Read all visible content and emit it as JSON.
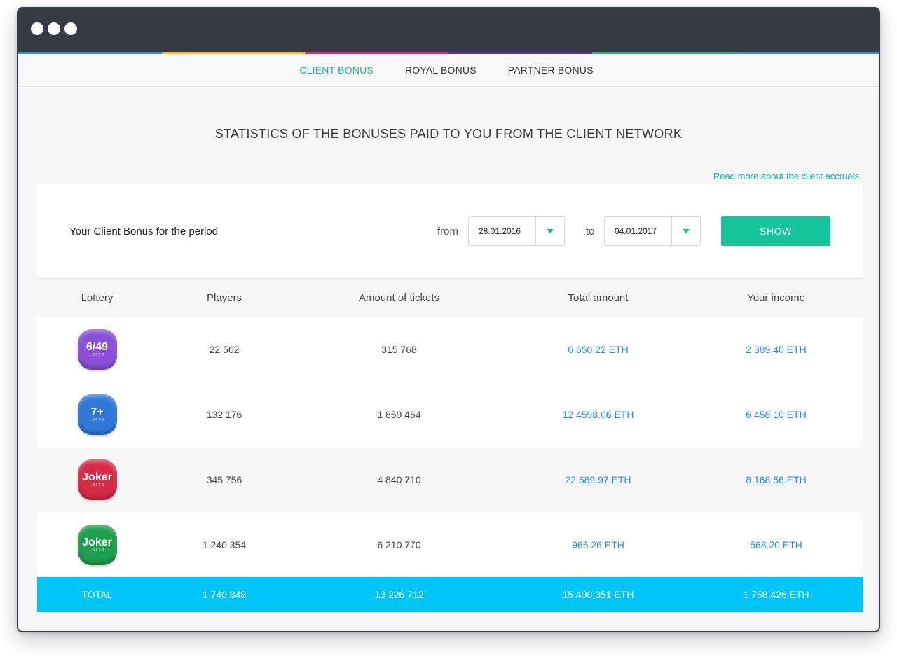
{
  "tabs": [
    {
      "label": "CLIENT BONUS",
      "active": true
    },
    {
      "label": "ROYAL BONUS",
      "active": false
    },
    {
      "label": "PARTNER BONUS",
      "active": false
    }
  ],
  "page_title": "STATISTICS OF THE BONUSES PAID TO YOU FROM THE CLIENT NETWORK",
  "read_more": "Read more about the client accruals",
  "filter": {
    "label": "Your Client Bonus for the period",
    "from_label": "from",
    "from_value": "28.01.2016",
    "to_label": "to",
    "to_value": "04.01.2017",
    "show_button": "SHOW"
  },
  "table": {
    "headers": [
      "Lottery",
      "Players",
      "Amount of tickets",
      "Total amount",
      "Your income"
    ],
    "rows": [
      {
        "badge": "6/49",
        "badge_sub": "LOTTO",
        "badge_color": "#8a4fd9",
        "players": "22 562",
        "tickets": "315 768",
        "total": "6 650.22 ETH",
        "income": "2 389.40 ETH"
      },
      {
        "badge": "7+",
        "badge_sub": "LOTTO",
        "badge_color": "#2f78d8",
        "players": "132 176",
        "tickets": "1 859 464",
        "total": "12 4598.06 ETH",
        "income": "6 458.10 ETH"
      },
      {
        "badge": "Joker",
        "badge_sub": "LOTTO",
        "badge_color": "#d52a48",
        "players": "345 756",
        "tickets": "4 840 710",
        "total": "22 689.97 ETH",
        "income": "8 168.56 ETH"
      },
      {
        "badge": "Joker",
        "badge_sub": "LOTTO",
        "badge_color": "#1f9e4e",
        "players": "1 240 354",
        "tickets": "6 210 770",
        "total": "965.26 ETH",
        "income": "568.20 ETH"
      }
    ],
    "total": {
      "label": "TOTAL",
      "players": "1 740 848",
      "tickets": "13 226 712",
      "total": "15 490 351 ETH",
      "income": "1 758 426 ETH"
    }
  },
  "colors": {
    "accent": "#10b99a",
    "eth_link": "#2a8fd6",
    "total_row": "#00c6f7",
    "titlebar": "#363a45",
    "stripe": [
      "#3c8fd9",
      "#f2b633",
      "#e0307a",
      "#5b2fb5",
      "#2bb57a",
      "#3c8fd9"
    ]
  }
}
